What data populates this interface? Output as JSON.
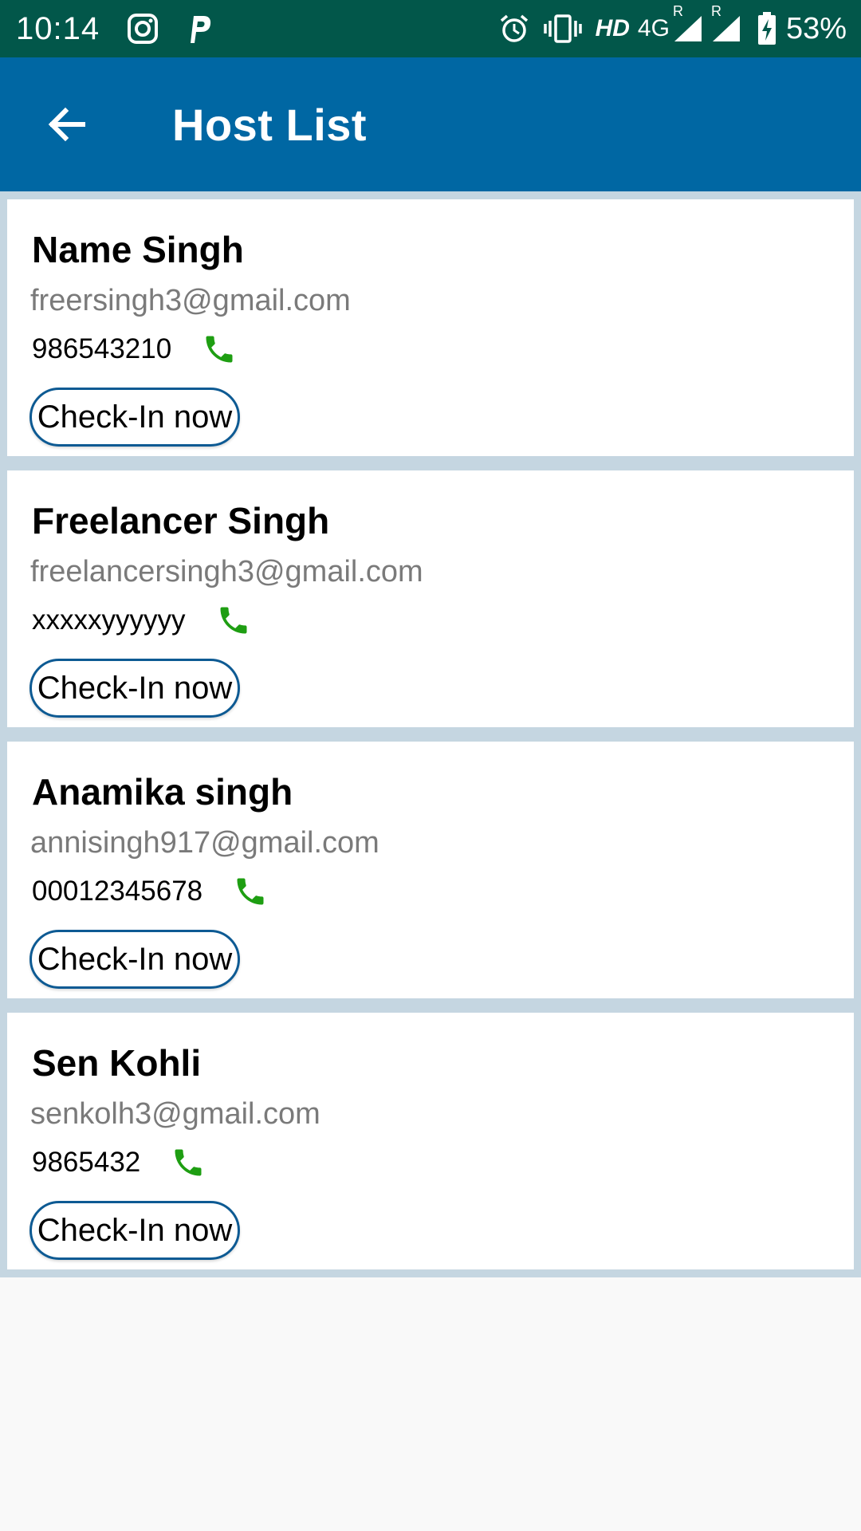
{
  "status_bar": {
    "time": "10:14",
    "network_label": "HD",
    "network_type": "4G",
    "roaming_1": "R",
    "roaming_2": "R",
    "battery": "53%",
    "icons": [
      "instagram-icon",
      "paytm-icon",
      "alarm-icon",
      "vibrate-icon",
      "signal-icon",
      "battery-charging-icon"
    ]
  },
  "app_bar": {
    "title": "Host List",
    "back_icon": "arrow-back-icon",
    "background": "#0067a3"
  },
  "hosts": [
    {
      "name": "Name Singh",
      "email": "freersingh3@gmail.com",
      "phone": "986543210",
      "action_label": "Check-In now"
    },
    {
      "name": "Freelancer Singh",
      "email": "freelancersingh3@gmail.com",
      "phone": "xxxxxyyyyyy",
      "action_label": "Check-In now"
    },
    {
      "name": "Anamika singh",
      "email": "annisingh917@gmail.com",
      "phone": "00012345678",
      "action_label": "Check-In now"
    },
    {
      "name": "Sen Kohli",
      "email": "senkolh3@gmail.com",
      "phone": "9865432",
      "action_label": "Check-In now"
    }
  ],
  "colors": {
    "status_bar": "#02574a",
    "accent": "#0067a3",
    "phone_icon": "#1e9e12",
    "email_text": "#7a7a7a",
    "list_background": "#c5d6e1"
  }
}
